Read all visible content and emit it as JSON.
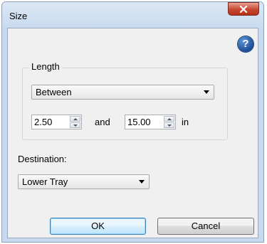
{
  "window": {
    "title": "Size"
  },
  "help": {
    "glyph": "?"
  },
  "length_group": {
    "label": "Length",
    "mode_select": {
      "value": "Between"
    },
    "from": {
      "value": "2.50"
    },
    "and_label": "and",
    "to": {
      "value": "15.00"
    },
    "unit_label": "in"
  },
  "destination": {
    "label": "Destination:",
    "select": {
      "value": "Lower Tray"
    }
  },
  "buttons": {
    "ok": "OK",
    "cancel": "Cancel"
  },
  "colors": {
    "close_button": "#c9472f",
    "help_icon": "#1c4c95",
    "default_button_border": "#3c7fb1"
  }
}
